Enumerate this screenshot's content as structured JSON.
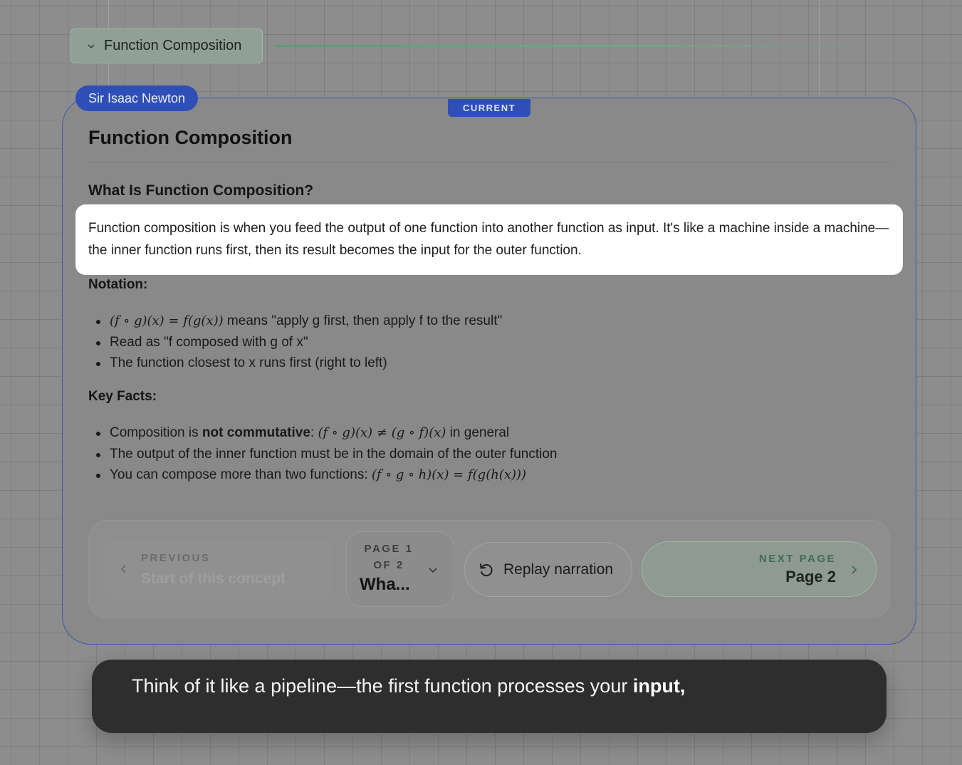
{
  "concept": {
    "label": "Function Composition"
  },
  "card": {
    "speaker": "Sir Isaac Newton",
    "current_tag": "CURRENT",
    "title": "Function Composition",
    "section_heading": "What Is Function Composition?",
    "intro": "Function composition is when you feed the output of one function into another function as input. It's like a machine inside a machine—the inner function runs first, then its result becomes the input for the outer function.",
    "notation_label": "Notation:",
    "notation_items": [
      {
        "math": "(f ∘ g)(x) = f(g(x))",
        "text": " means \"apply g first, then apply f to the result\""
      },
      {
        "text": "Read as \"f composed with g of x\""
      },
      {
        "text": "The function closest to x runs first (right to left)"
      }
    ],
    "keyfacts_label": "Key Facts:",
    "keyfacts_items": [
      {
        "pre": "Composition is ",
        "bold": "not commutative",
        "post": ": ",
        "math": "(f ∘ g)(x) ≠ (g ∘ f)(x)",
        "tail": " in general"
      },
      {
        "text": "The output of the inner function must be in the domain of the outer function"
      },
      {
        "pre": "You can compose more than two functions: ",
        "math": "(f ∘ g ∘ h)(x) = f(g(h(x)))"
      }
    ]
  },
  "nav": {
    "previous_kicker": "PREVIOUS",
    "previous_text": "Start of this concept",
    "page_kicker": "PAGE 1 OF 2",
    "page_value": "Wha...",
    "replay_label": "Replay narration",
    "next_kicker": "NEXT PAGE",
    "next_text": "Page 2"
  },
  "subtitle": {
    "text": "Think of it like a pipeline—the first function processes your ",
    "emphasis": "input,"
  }
}
